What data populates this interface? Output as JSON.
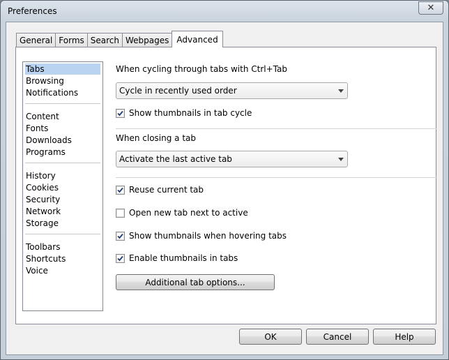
{
  "window": {
    "title": "Preferences",
    "close_symbol": "✕"
  },
  "tabs": [
    {
      "label": "General"
    },
    {
      "label": "Forms"
    },
    {
      "label": "Search"
    },
    {
      "label": "Webpages"
    },
    {
      "label": "Advanced",
      "active": true
    }
  ],
  "categories": [
    {
      "label": "Tabs",
      "selected": true
    },
    {
      "label": "Browsing"
    },
    {
      "label": "Notifications"
    },
    {
      "label": "Content"
    },
    {
      "label": "Fonts"
    },
    {
      "label": "Downloads"
    },
    {
      "label": "Programs"
    },
    {
      "label": "History"
    },
    {
      "label": "Cookies"
    },
    {
      "label": "Security"
    },
    {
      "label": "Network"
    },
    {
      "label": "Storage"
    },
    {
      "label": "Toolbars"
    },
    {
      "label": "Shortcuts"
    },
    {
      "label": "Voice"
    }
  ],
  "tabs_page": {
    "cycling_heading": "When cycling through tabs with Ctrl+Tab",
    "cycle_select_value": "Cycle in recently used order",
    "show_thumbnails_cycle": {
      "label": "Show thumbnails in tab cycle",
      "checked": true
    },
    "closing_heading": "When closing a tab",
    "closing_select_value": "Activate the last active tab",
    "reuse_current_tab": {
      "label": "Reuse current tab",
      "checked": true
    },
    "open_next_to_active": {
      "label": "Open new tab next to active",
      "checked": false
    },
    "thumbnails_hovering": {
      "label": "Show thumbnails when hovering tabs",
      "checked": true
    },
    "thumbnails_in_tabs": {
      "label": "Enable thumbnails in tabs",
      "checked": true
    },
    "additional_options_label": "Additional tab options..."
  },
  "footer": {
    "ok_label": "OK",
    "cancel_label": "Cancel",
    "help_label": "Help"
  }
}
